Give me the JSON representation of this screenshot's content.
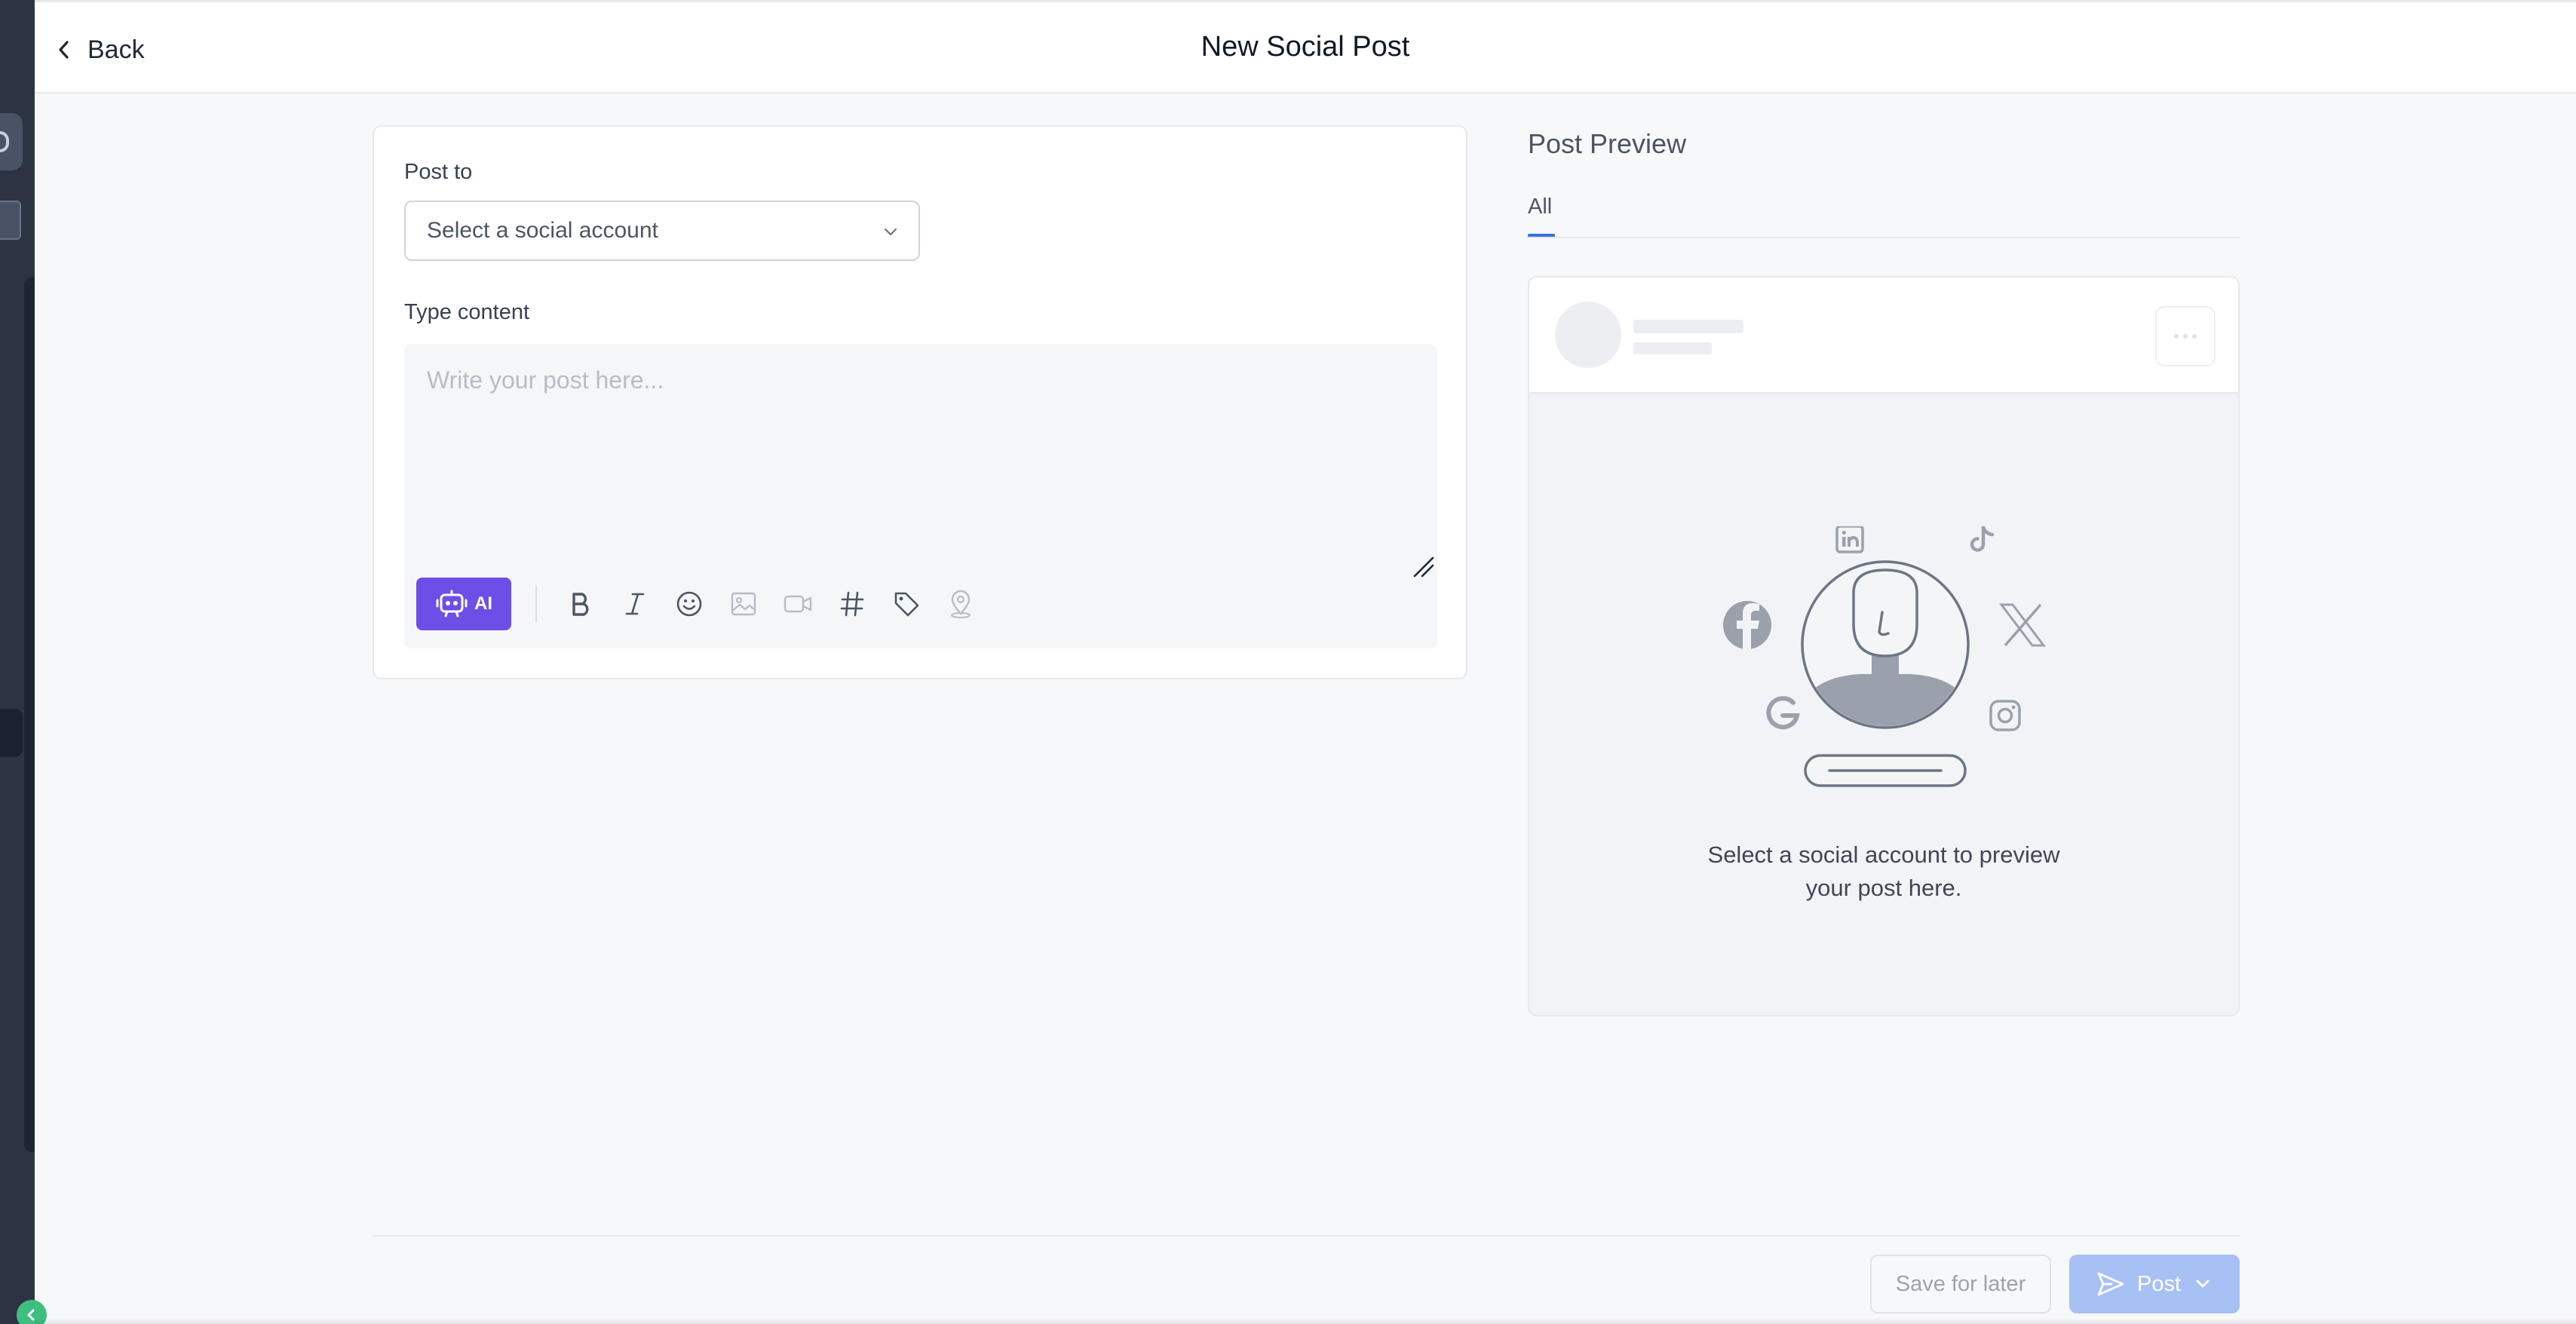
{
  "header": {
    "back_label": "Back",
    "title": "New Social Post"
  },
  "composer": {
    "post_to_label": "Post to",
    "account_select_placeholder": "Select a social account",
    "type_content_label": "Type content",
    "editor_placeholder": "Write your post here...",
    "ai_button_label": "AI",
    "toolbar_icons": [
      "ai-robot-icon",
      "bold-icon",
      "italic-icon",
      "emoji-icon",
      "image-icon",
      "video-icon",
      "hashtag-icon",
      "tag-icon",
      "location-icon"
    ]
  },
  "preview": {
    "title": "Post Preview",
    "tabs": [
      {
        "label": "All",
        "active": true
      }
    ],
    "empty_message": "Select a social account to preview your post here.",
    "platform_icons": [
      "linkedin-icon",
      "tiktok-icon",
      "facebook-icon",
      "x-icon",
      "google-icon",
      "instagram-icon"
    ]
  },
  "footer": {
    "save_label": "Save for later",
    "post_label": "Post"
  },
  "colors": {
    "ai_button": "#6d4ee6",
    "post_button_disabled": "#a7c1f5",
    "tab_accent": "#3b6fe0",
    "sidebar": "#2c3444",
    "collapse_toggle": "#3fbf7f"
  }
}
